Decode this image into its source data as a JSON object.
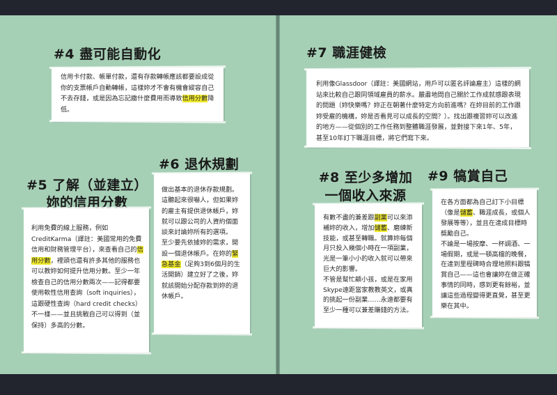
{
  "sec4": {
    "title": "#4 盡可能自動化",
    "body_a": "信用卡付款、帳單付款，還有存款轉帳應該都要設成從你的支票帳戶自動轉帳，這樣妳才不會有機會縱容自己不去存錢，或是因為忘記繳什麼費用而導致",
    "hl1": "信用分數",
    "body_b": "降低。"
  },
  "sec5": {
    "title_line1": "#5 了解（並建立）",
    "title_line2": "妳的信用分數",
    "body_a": "利用免費的線上服務，例如CreditKarma（譯註：美國常用的免費信用和財務管理平台），來查看自己的",
    "hl1": "信用分數",
    "body_b": "，裡頭也還有許多其他的服務也可以教妳如何提升信用分數。至少一年檢查自己的信用分數兩次——記得都要使用軟性信用查詢（soft inquiries），這跟硬性查詢（hard credit checks）不一樣——並且挑戰自己可以得到（並保持）多高的分數。"
  },
  "sec6": {
    "title": "#6 退休規劃",
    "body_a": "做出基本的退休存款規劃。這聽起來很嚇人，但如果妳的雇主有提供退休帳戶，妳就可以跟公司的人資約個面談來討論妳所有的選項。",
    "body_b": "至少要先依據妳的需求，開設一個退休帳戶。在妳的",
    "hl1": "緊急基金",
    "body_c": "（足夠3到6個月的生活開銷）建立好了之後，妳就該開始分配存款到妳的退休帳戶。"
  },
  "sec7": {
    "title": "#7 職涯健檢",
    "body": "利用像Glassdoor（譯註：美國網站，用戶可以匿名評論雇主）這樣的網站來比較自己跟同領域雇員的薪水。嚴肅地問自己關於工作成就感跟表現的問題（妳快樂嗎？妳正在朝著什麼特定方向前進嗎？在妳目前的工作跟妳受雇的機構，妳是否看見可以成長的空間？）。找出跟複習妳可以改進的地方——從個別的工作任務到整體職涯發展，並對接下來1年、5年，甚至10年訂下職涯目標，將它們寫下來。"
  },
  "sec8": {
    "title_line1": "#8 至少多增加",
    "title_line2": "一個收入來源",
    "body_a": "有數不盡的兼差跟",
    "hl1": "副業",
    "body_b": "可以來添補妳的收入，增加",
    "hl2": "儲蓄",
    "body_c": "、磨練新技能，或甚至轉職。就算妳每個月只投入幾個小時在一項副業，光是一筆小小的收入就可以帶來巨大的影響。",
    "body_d": "不管是幫忙顧小孩，或是在家用Skype遠距當家教教英文，或真的挑起一份副業……永遠都要有至少一種可以兼差賺錢的方法。"
  },
  "sec9": {
    "title": "#9 犒賞自己",
    "body_a": "在各方面都為自己訂下小目標（像是",
    "hl1": "儲蓄",
    "body_b": "、職涯成長，或個人發展等等），並且在達成目標時獎勵自己。",
    "body_c": "不論是一場按摩、一杯調酒、一場假期，或是一頓高檔的晚餐，在達到里程碑時合理地照料跟犒賞自己——這也會讓妳在做正確事情的同時，感到更有餘裕，並讓這些過程變得更直覺，甚至更樂在其中。"
  },
  "colors": {
    "page_bg": "#a6d0b6",
    "frame": "#22242e",
    "highlight": "#f1ea2b",
    "card": "#ffffff"
  }
}
